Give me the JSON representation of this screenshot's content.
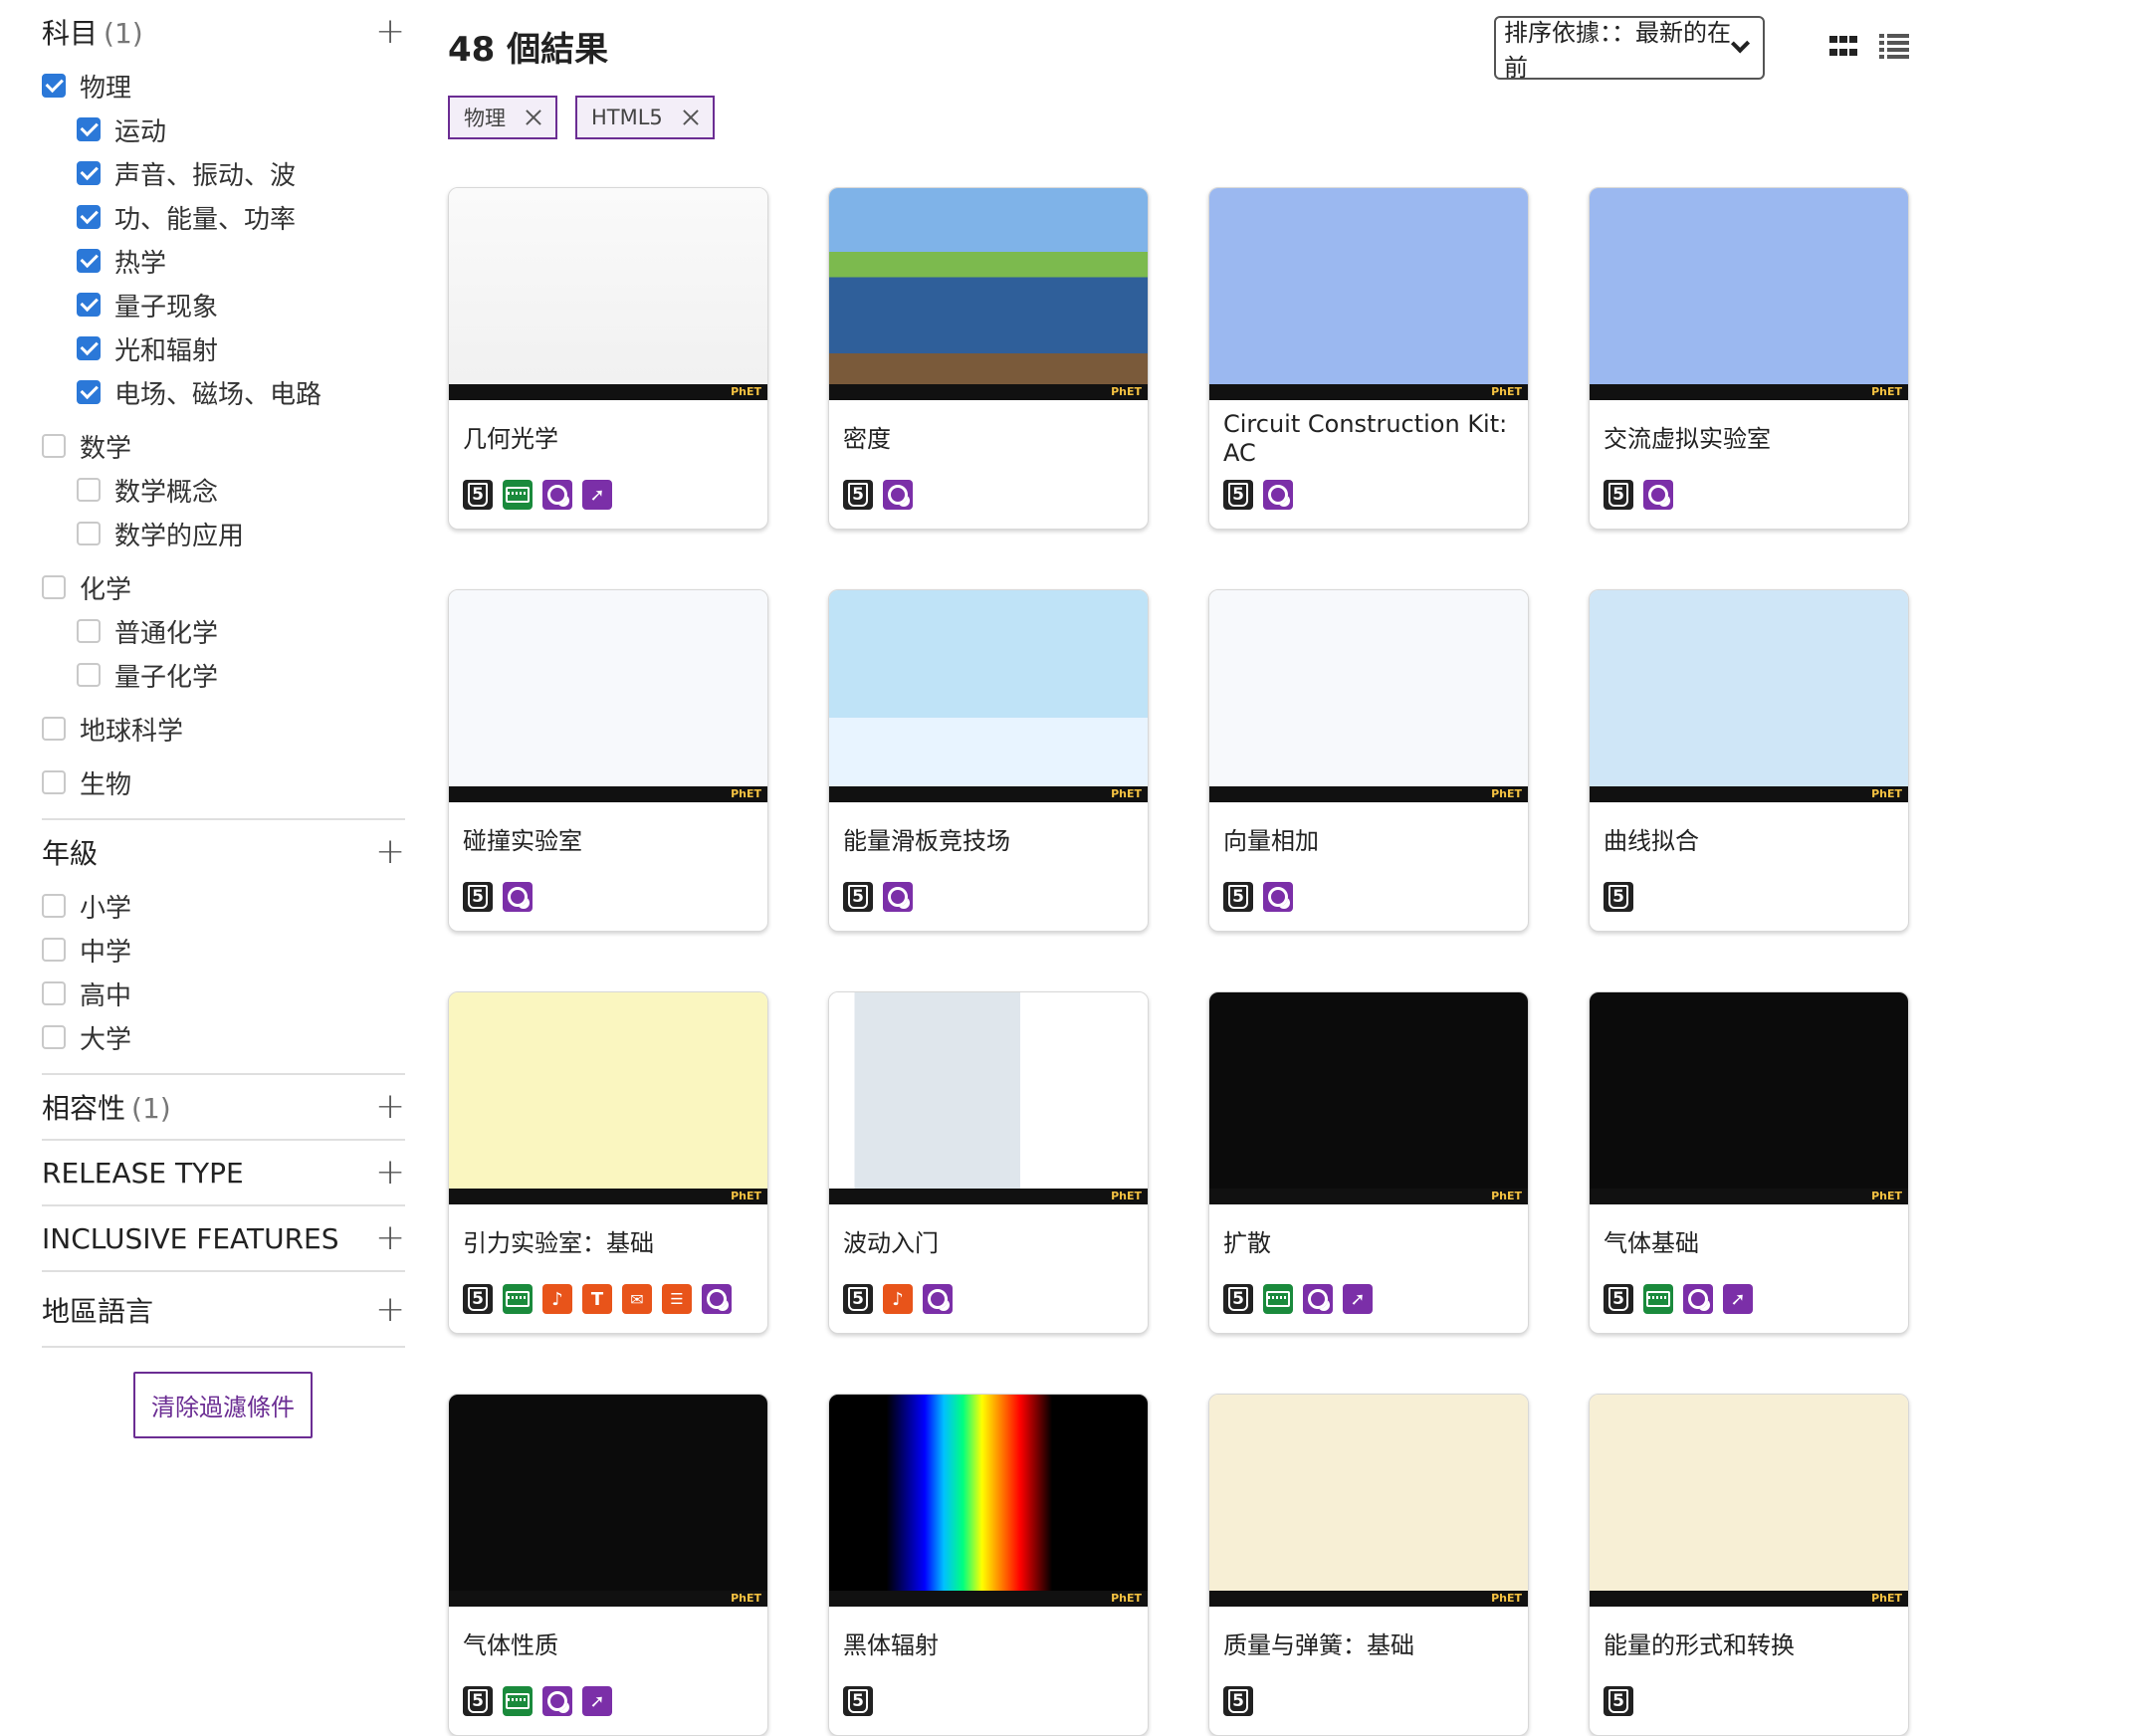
{
  "filters": {
    "subject": {
      "title": "科目",
      "count": "(1)",
      "groups": [
        {
          "label": "物理",
          "checked": true,
          "children": [
            {
              "label": "运动",
              "checked": true
            },
            {
              "label": "声音、振动、波",
              "checked": true
            },
            {
              "label": "功、能量、功率",
              "checked": true
            },
            {
              "label": "热学",
              "checked": true
            },
            {
              "label": "量子现象",
              "checked": true
            },
            {
              "label": "光和辐射",
              "checked": true
            },
            {
              "label": "电场、磁场、电路",
              "checked": true
            }
          ]
        },
        {
          "label": "数学",
          "checked": false,
          "children": [
            {
              "label": "数学概念",
              "checked": false
            },
            {
              "label": "数学的应用",
              "checked": false
            }
          ]
        },
        {
          "label": "化学",
          "checked": false,
          "children": [
            {
              "label": "普通化学",
              "checked": false
            },
            {
              "label": "量子化学",
              "checked": false
            }
          ]
        },
        {
          "label": "地球科学",
          "checked": false,
          "children": []
        },
        {
          "label": "生物",
          "checked": false,
          "children": []
        }
      ]
    },
    "grade": {
      "title": "年級",
      "items": [
        "小学",
        "中学",
        "高中",
        "大学"
      ]
    },
    "compatibility": {
      "title": "相容性",
      "count": "(1)"
    },
    "release_type": {
      "title": "RELEASE TYPE"
    },
    "inclusive": {
      "title": "INCLUSIVE FEATURES"
    },
    "locale": {
      "title": "地區語言"
    },
    "clear_label": "清除過濾條件"
  },
  "results": {
    "count_label": "48 個結果",
    "sort_label": "排序依據：：最新的在前",
    "chips": [
      "物理",
      "HTML5"
    ]
  },
  "sims": [
    {
      "title": "几何光学",
      "thumb": "light",
      "icons": [
        "html5-icon",
        "keyboard-icon",
        "zoom-icon",
        "pointer-icon"
      ]
    },
    {
      "title": "密度",
      "thumb": "density",
      "icons": [
        "html5-icon",
        "zoom-icon"
      ]
    },
    {
      "title": "Circuit Construction Kit: AC",
      "thumb": "blue",
      "icons": [
        "html5-icon",
        "zoom-icon"
      ]
    },
    {
      "title": "交流虚拟实验室",
      "thumb": "blue",
      "icons": [
        "html5-icon",
        "zoom-icon"
      ]
    },
    {
      "title": "碰撞实验室",
      "thumb": "white",
      "icons": [
        "html5-icon",
        "zoom-icon"
      ]
    },
    {
      "title": "能量滑板竞技场",
      "thumb": "sky",
      "icons": [
        "html5-icon",
        "zoom-icon"
      ]
    },
    {
      "title": "向量相加",
      "thumb": "white",
      "icons": [
        "html5-icon",
        "zoom-icon"
      ]
    },
    {
      "title": "曲线拟合",
      "thumb": "lightblue",
      "icons": [
        "html5-icon"
      ]
    },
    {
      "title": "引力实验室：基础",
      "thumb": "yellow",
      "icons": [
        "html5-icon",
        "keyboard-icon",
        "sound-icon",
        "description-icon",
        "voicing-icon",
        "voicing2-icon",
        "zoom-icon"
      ]
    },
    {
      "title": "波动入门",
      "thumb": "waves",
      "icons": [
        "html5-icon",
        "sound-icon",
        "zoom-icon"
      ]
    },
    {
      "title": "扩散",
      "thumb": "dark",
      "icons": [
        "html5-icon",
        "keyboard-icon",
        "zoom-icon",
        "pointer-icon"
      ]
    },
    {
      "title": "气体基础",
      "thumb": "dark",
      "icons": [
        "html5-icon",
        "keyboard-icon",
        "zoom-icon",
        "pointer-icon"
      ]
    },
    {
      "title": "气体性质",
      "thumb": "dark",
      "icons": [
        "html5-icon",
        "keyboard-icon",
        "zoom-icon",
        "pointer-icon"
      ]
    },
    {
      "title": "黑体辐射",
      "thumb": "spectrum",
      "icons": [
        "html5-icon"
      ]
    },
    {
      "title": "质量与弹簧：基础",
      "thumb": "cream",
      "icons": [
        "html5-icon"
      ]
    },
    {
      "title": "能量的形式和转换",
      "thumb": "cream",
      "icons": [
        "html5-icon"
      ]
    }
  ],
  "colors": {
    "accent_purple": "#6b2d93",
    "checkbox_blue": "#2b78d8",
    "keyboard_green": "#1a8a3c",
    "sound_orange": "#e8541a"
  }
}
